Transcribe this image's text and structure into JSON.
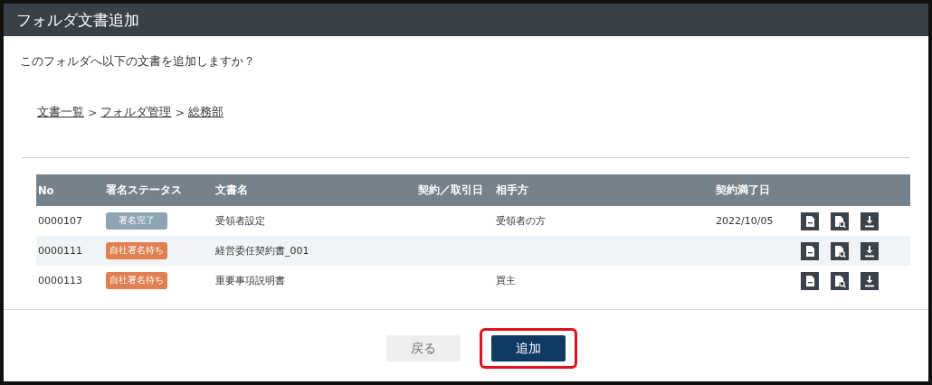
{
  "window": {
    "title": "フォルダ文書追加"
  },
  "message": "このフォルダへ以下の文書を追加しますか？",
  "breadcrumb": [
    "文書一覧",
    "フォルダ管理",
    "総務部"
  ],
  "breadcrumb_separator": ">",
  "table": {
    "columns": [
      "No",
      "署名ステータス",
      "文書名",
      "契約／取引日",
      "相手方",
      "契約満了日"
    ],
    "rows": [
      {
        "no": "0000107",
        "status": {
          "label": "署名完了",
          "color": "#8ea4b3"
        },
        "name": "受領者設定",
        "party": "受領者の方",
        "end_date": "2022/10/05"
      },
      {
        "no": "0000111",
        "status": {
          "label": "自社署名待ち",
          "color": "#e07f50"
        },
        "name": "経営委任契約書_001"
      },
      {
        "no": "0000113",
        "status": {
          "label": "自社署名待ち",
          "color": "#e07f50"
        },
        "name": "重要事項説明書",
        "party": "買主"
      }
    ]
  },
  "buttons": [
    {
      "label": "戻る",
      "kind": "secondary",
      "highlighted": false
    },
    {
      "label": "追加",
      "kind": "primary",
      "highlighted": true
    }
  ]
}
